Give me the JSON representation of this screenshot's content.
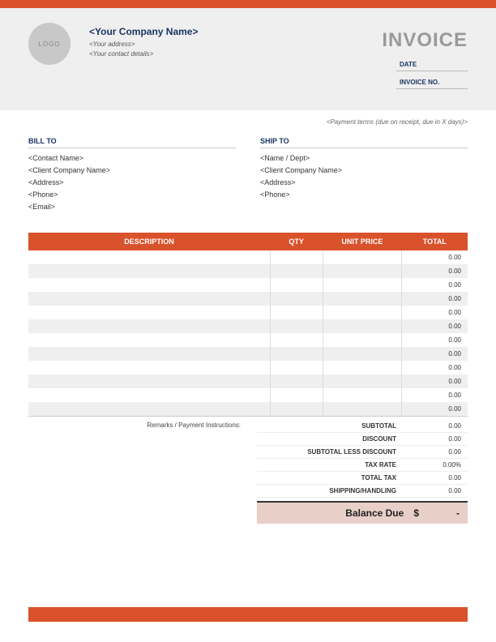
{
  "logo_text": "LOGO",
  "company": {
    "name": "<Your Company Name>",
    "address": "<Your address>",
    "contact": "<Your contact details>"
  },
  "invoice_title": "INVOICE",
  "meta": {
    "date_label": "DATE",
    "invoice_no_label": "INVOICE NO."
  },
  "payment_terms": "<Payment terms (due on receipt, due in X days)>",
  "bill_to": {
    "heading": "BILL TO",
    "contact": "<Contact Name>",
    "company": "<Client Company Name>",
    "address": "<Address>",
    "phone": "<Phone>",
    "email": "<Email>"
  },
  "ship_to": {
    "heading": "SHIP TO",
    "name": "<Name / Dept>",
    "company": "<Client Company Name>",
    "address": "<Address>",
    "phone": "<Phone>"
  },
  "columns": {
    "description": "DESCRIPTION",
    "qty": "QTY",
    "unit_price": "UNIT PRICE",
    "total": "TOTAL"
  },
  "rows": [
    {
      "total": "0.00"
    },
    {
      "total": "0.00"
    },
    {
      "total": "0.00"
    },
    {
      "total": "0.00"
    },
    {
      "total": "0.00"
    },
    {
      "total": "0.00"
    },
    {
      "total": "0.00"
    },
    {
      "total": "0.00"
    },
    {
      "total": "0.00"
    },
    {
      "total": "0.00"
    },
    {
      "total": "0.00"
    },
    {
      "total": "0.00"
    }
  ],
  "remarks_label": "Remarks / Payment Instructions:",
  "summary": {
    "subtotal": {
      "label": "SUBTOTAL",
      "value": "0.00"
    },
    "discount": {
      "label": "DISCOUNT",
      "value": "0.00"
    },
    "subtotal_less": {
      "label": "SUBTOTAL LESS DISCOUNT",
      "value": "0.00"
    },
    "tax_rate": {
      "label": "TAX RATE",
      "value": "0.00%"
    },
    "total_tax": {
      "label": "TOTAL TAX",
      "value": "0.00"
    },
    "shipping": {
      "label": "SHIPPING/HANDLING",
      "value": "0.00"
    }
  },
  "balance": {
    "label": "Balance Due",
    "currency": "$",
    "value": "-"
  }
}
